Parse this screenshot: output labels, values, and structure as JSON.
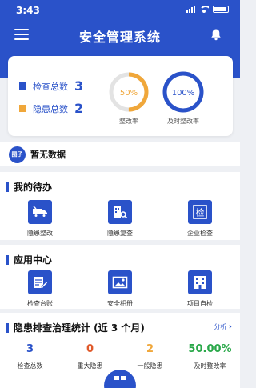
{
  "status": {
    "time": "3:43"
  },
  "header": {
    "title": "安全管理系统"
  },
  "stats": {
    "check_total_label": "检查总数",
    "check_total_value": "3",
    "hazard_total_label": "隐患总数",
    "hazard_total_value": "2",
    "rect_rate_value": "50%",
    "rect_rate_fraction": 0.5,
    "rect_rate_label": "整改率",
    "timely_rate_value": "100%",
    "timely_rate_fraction": 1.0,
    "timely_rate_label": "及时整改率",
    "colors": {
      "check": "#2a52c9",
      "hazard": "#f0a73a",
      "ring_orange": "#f0a73a",
      "ring_blue": "#2a52c9"
    }
  },
  "notice": {
    "logo_text": "圈子",
    "text": "暂无数据"
  },
  "todo": {
    "title": "我的待办",
    "items": [
      {
        "label": "隐患整改",
        "icon": "truck-icon"
      },
      {
        "label": "隐患复查",
        "icon": "building-search-icon"
      },
      {
        "label": "企业检查",
        "icon": "inspection-icon"
      }
    ]
  },
  "apps": {
    "title": "应用中心",
    "items": [
      {
        "label": "检查台账",
        "icon": "ledger-edit-icon"
      },
      {
        "label": "安全相册",
        "icon": "photo-album-icon"
      },
      {
        "label": "项目自检",
        "icon": "building-icon"
      }
    ]
  },
  "summary": {
    "title": "隐患排查治理统计 (近 3 个月)",
    "link": "分析",
    "items": [
      {
        "value": "3",
        "label": "检查总数",
        "color": "#2a52c9"
      },
      {
        "value": "0",
        "label": "重大隐患",
        "color": "#e0592a"
      },
      {
        "value": "2",
        "label": "一般隐患",
        "color": "#f0a73a"
      },
      {
        "value": "50.00%",
        "label": "及时整改率",
        "color": "#2aa84a"
      }
    ]
  }
}
